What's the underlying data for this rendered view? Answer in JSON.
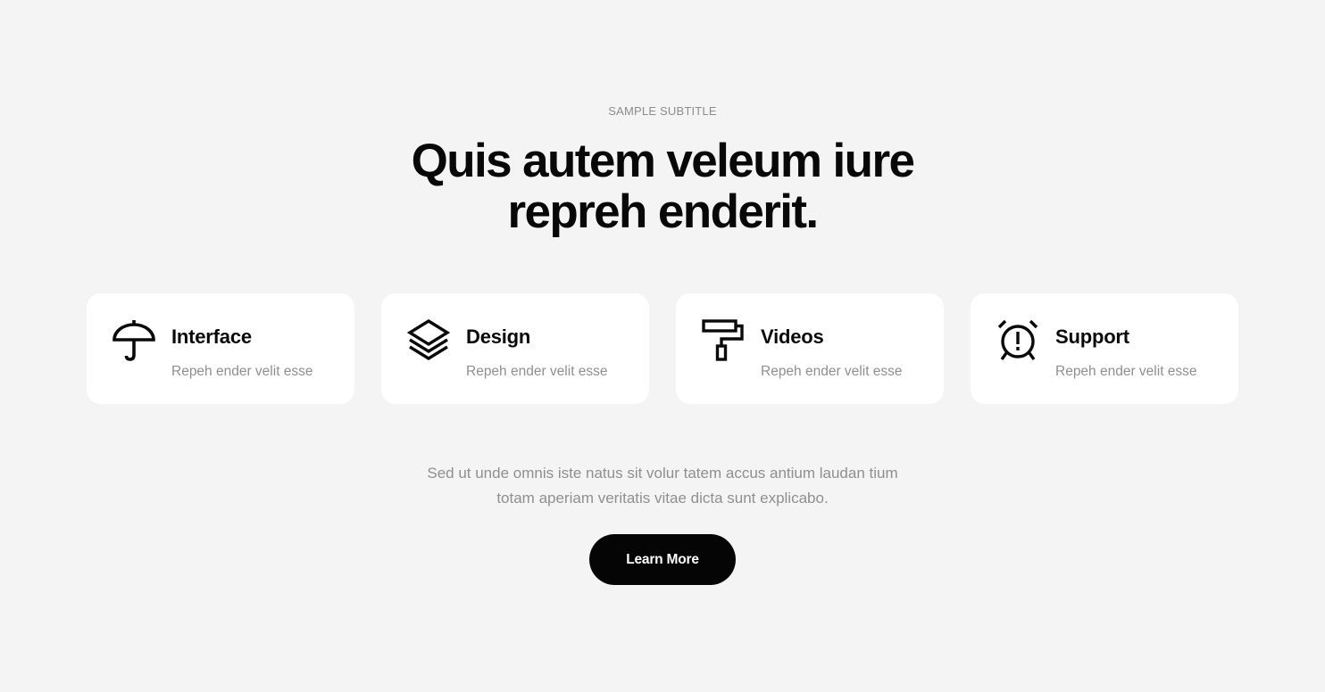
{
  "hero": {
    "subtitle": "SAMPLE SUBTITLE",
    "title_line_1": "Quis autem veleum iure",
    "title_line_2": "repreh enderit."
  },
  "features": [
    {
      "icon": "umbrella-icon",
      "title": "Interface",
      "text": "Repeh ender velit esse"
    },
    {
      "icon": "layers-icon",
      "title": "Design",
      "text": "Repeh ender velit esse"
    },
    {
      "icon": "paint-roller-icon",
      "title": "Videos",
      "text": "Repeh ender velit esse"
    },
    {
      "icon": "alarm-clock-icon",
      "title": "Support",
      "text": "Repeh ender velit esse"
    }
  ],
  "description": {
    "line_1": "Sed ut unde omnis iste natus sit volur tatem accus antium laudan tium",
    "line_2": "totam aperiam veritatis vitae dicta sunt explicabo."
  },
  "cta": {
    "label": "Learn More"
  },
  "colors": {
    "background": "#f4f4f4",
    "card": "#ffffff",
    "heading": "#080808",
    "muted_text": "#8f8f8f",
    "button": "#050505",
    "button_text": "#ffffff"
  }
}
